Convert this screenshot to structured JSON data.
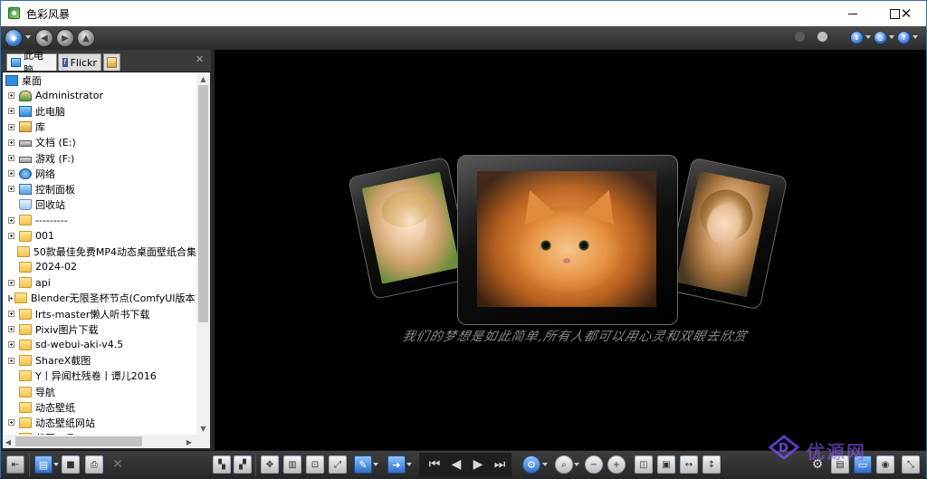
{
  "window": {
    "title": "色彩风暴"
  },
  "left_panel": {
    "tabs": [
      {
        "label": "此电脑",
        "icon": "computer-icon"
      },
      {
        "label": "Flickr",
        "icon": "flickr-icon"
      },
      {
        "label": "",
        "icon": "favorites-icon"
      }
    ],
    "tree": [
      {
        "label": "桌面",
        "icon": "desktop-icon",
        "expandable": false,
        "indent": 0
      },
      {
        "label": "Administrator",
        "icon": "user-icon",
        "expandable": true,
        "indent": 1
      },
      {
        "label": "此电脑",
        "icon": "computer-icon",
        "expandable": true,
        "indent": 1
      },
      {
        "label": "库",
        "icon": "library-icon",
        "expandable": true,
        "indent": 1
      },
      {
        "label": "文档 (E:)",
        "icon": "drive-icon",
        "expandable": true,
        "indent": 1
      },
      {
        "label": "游戏 (F:)",
        "icon": "drive-icon",
        "expandable": true,
        "indent": 1
      },
      {
        "label": "网络",
        "icon": "network-icon",
        "expandable": true,
        "indent": 1
      },
      {
        "label": "控制面板",
        "icon": "control-panel-icon",
        "expandable": true,
        "indent": 1
      },
      {
        "label": "回收站",
        "icon": "recycle-bin-icon",
        "expandable": false,
        "indent": 1
      },
      {
        "label": "---------",
        "icon": "folder-icon",
        "expandable": true,
        "indent": 1
      },
      {
        "label": "001",
        "icon": "folder-icon",
        "expandable": true,
        "indent": 1
      },
      {
        "label": "50款最佳免费MP4动态桌面壁纸合集",
        "icon": "folder-icon",
        "expandable": false,
        "indent": 1
      },
      {
        "label": "2024-02",
        "icon": "folder-icon",
        "expandable": false,
        "indent": 1
      },
      {
        "label": "api",
        "icon": "folder-icon",
        "expandable": true,
        "indent": 1
      },
      {
        "label": "Blender无限圣杯节点(ComfyUI版本)",
        "icon": "folder-icon",
        "expandable": true,
        "indent": 1
      },
      {
        "label": "lrts-master懒人听书下载",
        "icon": "folder-icon",
        "expandable": true,
        "indent": 1
      },
      {
        "label": "Pixiv图片下载",
        "icon": "folder-icon",
        "expandable": true,
        "indent": 1
      },
      {
        "label": "sd-webui-aki-v4.5",
        "icon": "folder-icon",
        "expandable": true,
        "indent": 1
      },
      {
        "label": "ShareX截图",
        "icon": "folder-icon",
        "expandable": true,
        "indent": 1
      },
      {
        "label": "Y丨异闻杜残卷丨谭儿2016",
        "icon": "folder-icon",
        "expandable": false,
        "indent": 1
      },
      {
        "label": "导航",
        "icon": "folder-icon",
        "expandable": false,
        "indent": 1
      },
      {
        "label": "动态壁纸",
        "icon": "folder-icon",
        "expandable": false,
        "indent": 1
      },
      {
        "label": "动态壁纸网站",
        "icon": "folder-icon",
        "expandable": true,
        "indent": 1
      },
      {
        "label": "截图工具",
        "icon": "folder-icon",
        "expandable": true,
        "indent": 1
      }
    ]
  },
  "viewer": {
    "caption": "我们的梦想是如此简单,所有人都可以用心灵和双眼去欣赏"
  },
  "watermark": {
    "text": "优源网"
  },
  "colors": {
    "toolbar": "#2b2b2b",
    "accent_blue": "#2f6fc7",
    "folder_yellow": "#f0c24a"
  }
}
